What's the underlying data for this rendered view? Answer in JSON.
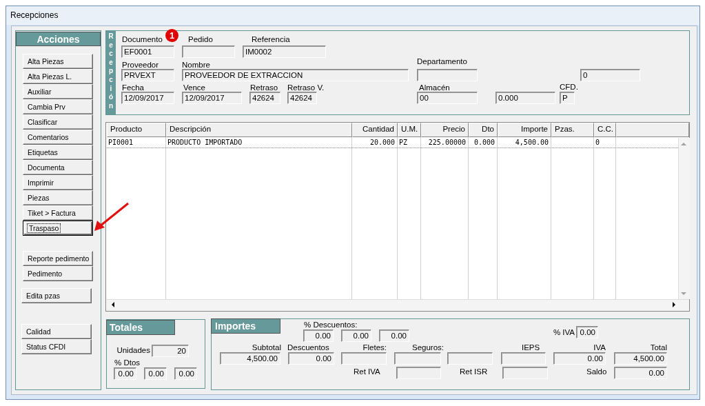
{
  "window": {
    "title": "Recepciones"
  },
  "actions": {
    "title": "Acciones",
    "button_groups": [
      [
        {
          "label": "Alta Piezas",
          "focused": false
        },
        {
          "label": "Alta Piezas L.",
          "focused": false
        },
        {
          "label": "Auxiliar",
          "focused": false
        },
        {
          "label": "Cambia Prv",
          "focused": false
        },
        {
          "label": "Clasificar",
          "focused": false
        },
        {
          "label": "Comentarios",
          "focused": false
        },
        {
          "label": "Etiquetas",
          "focused": false
        },
        {
          "label": "Documenta",
          "focused": false
        },
        {
          "label": "Imprimir",
          "focused": false
        },
        {
          "label": "Piezas",
          "focused": false
        },
        {
          "label": "Tiket > Factura",
          "focused": false
        },
        {
          "label": "Traspaso",
          "focused": true
        }
      ],
      [
        {
          "label": "Reporte pedimento",
          "focused": false
        },
        {
          "label": "Pedimento",
          "focused": false
        }
      ],
      [
        {
          "label": "Edita pzas",
          "focused": false
        }
      ],
      [
        {
          "label": "Calidad",
          "focused": false
        },
        {
          "label": "Status CFDI",
          "focused": false
        }
      ]
    ]
  },
  "header": {
    "side_label": "Recepción",
    "badge": "1",
    "fields": [
      {
        "label": "Documento",
        "value": "EF0001"
      },
      {
        "label": "Pedido"
      },
      {
        "label": "Referencia",
        "value": "IM0002"
      },
      {
        "label": "Proveedor",
        "value": "PRVEXT"
      },
      {
        "label": "Nombre",
        "value": "PROVEEDOR DE EXTRACCION"
      },
      {
        "label": "Departamento"
      },
      {
        "value": "0"
      },
      {
        "label": "Fecha",
        "value": "12/09/2017"
      },
      {
        "label": "Vence",
        "value": "12/09/2017"
      },
      {
        "label": "Retraso",
        "value": "42624"
      },
      {
        "label": "Retraso V.",
        "value": "42624"
      },
      {
        "label": "Almacén",
        "value": "00"
      },
      {
        "value": "0.000"
      },
      {
        "label": "CFD.",
        "value": "P"
      }
    ]
  },
  "table": {
    "columns": [
      "Producto",
      "Descripción",
      "Cantidad",
      "U.M.",
      "Precio",
      "Dto",
      "Importe",
      "Pzas.",
      "C.C."
    ],
    "rows": [
      {
        "cells": [
          "PI0001",
          "PRODUCTO IMPORTADO",
          "20.000",
          "PZ",
          "225.00000",
          "0.000",
          "4,500.00",
          null,
          "0"
        ]
      }
    ]
  },
  "totales": {
    "title": "Totales",
    "unidades": {
      "label": "Unidades",
      "value": "20"
    },
    "dtos_label": "% Dtos",
    "dtos": [
      "0.00",
      "0.00",
      "0.00"
    ]
  },
  "importes": {
    "title": "Importes",
    "descuentos_label": "% Descuentos:",
    "descuentos": [
      "0.00",
      "0.00",
      "0.00"
    ],
    "iva_pct": {
      "label": "% IVA",
      "value": "0.00"
    },
    "fields": [
      {
        "label": "Subtotal",
        "value": "4,500.00"
      },
      {
        "label": "Descuentos",
        "value": "0.00"
      },
      {
        "label": "Fletes:"
      },
      {
        "label": "Seguros:"
      },
      {
        "label": "IEPS"
      },
      {
        "label": "IVA",
        "value": "0.00"
      },
      {
        "label": "Total",
        "value": "4,500.00"
      },
      {
        "label": "Ret IVA"
      },
      {
        "label": "Ret ISR"
      },
      {
        "label": "Saldo",
        "value": "0.00"
      }
    ]
  }
}
